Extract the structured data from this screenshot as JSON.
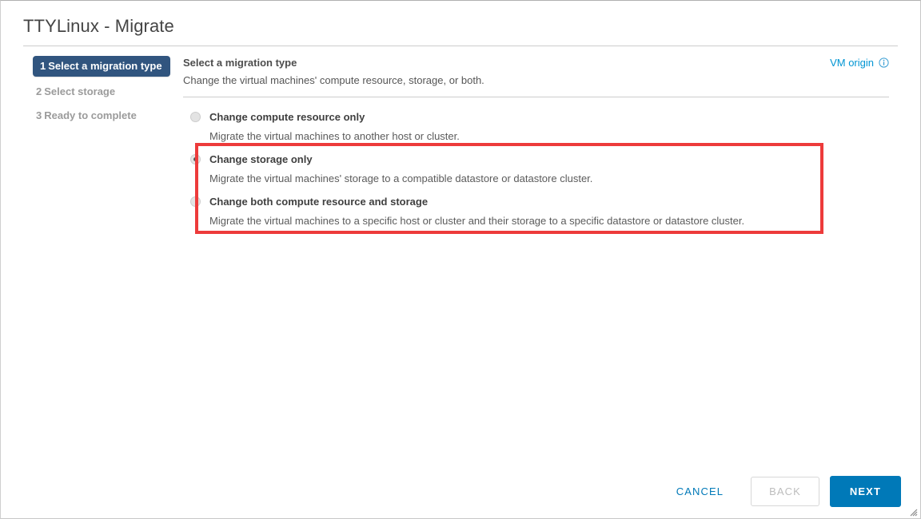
{
  "window": {
    "title": "TTYLinux - Migrate"
  },
  "steps": [
    {
      "num": "1",
      "label": "Select a migration type",
      "active": true
    },
    {
      "num": "2",
      "label": "Select storage",
      "active": false
    },
    {
      "num": "3",
      "label": "Ready to complete",
      "active": false
    }
  ],
  "content": {
    "title": "Select a migration type",
    "subtitle": "Change the virtual machines' compute resource, storage, or both.",
    "vm_origin_label": "VM origin",
    "info_icon": "info-circle-icon"
  },
  "options": [
    {
      "label": "Change compute resource only",
      "description": "Migrate the virtual machines to another host or cluster.",
      "selected": false
    },
    {
      "label": "Change storage only",
      "description": "Migrate the virtual machines' storage to a compatible datastore or datastore cluster.",
      "selected": true
    },
    {
      "label": "Change both compute resource and storage",
      "description": "Migrate the virtual machines to a specific host or cluster and their storage to a specific datastore or datastore cluster.",
      "selected": false
    }
  ],
  "footer": {
    "cancel_label": "CANCEL",
    "back_label": "BACK",
    "next_label": "NEXT"
  },
  "colors": {
    "active_step_bg": "#31557f",
    "primary_button": "#0079b8",
    "link": "#0095d3",
    "highlight_box": "#ed3b3b"
  }
}
